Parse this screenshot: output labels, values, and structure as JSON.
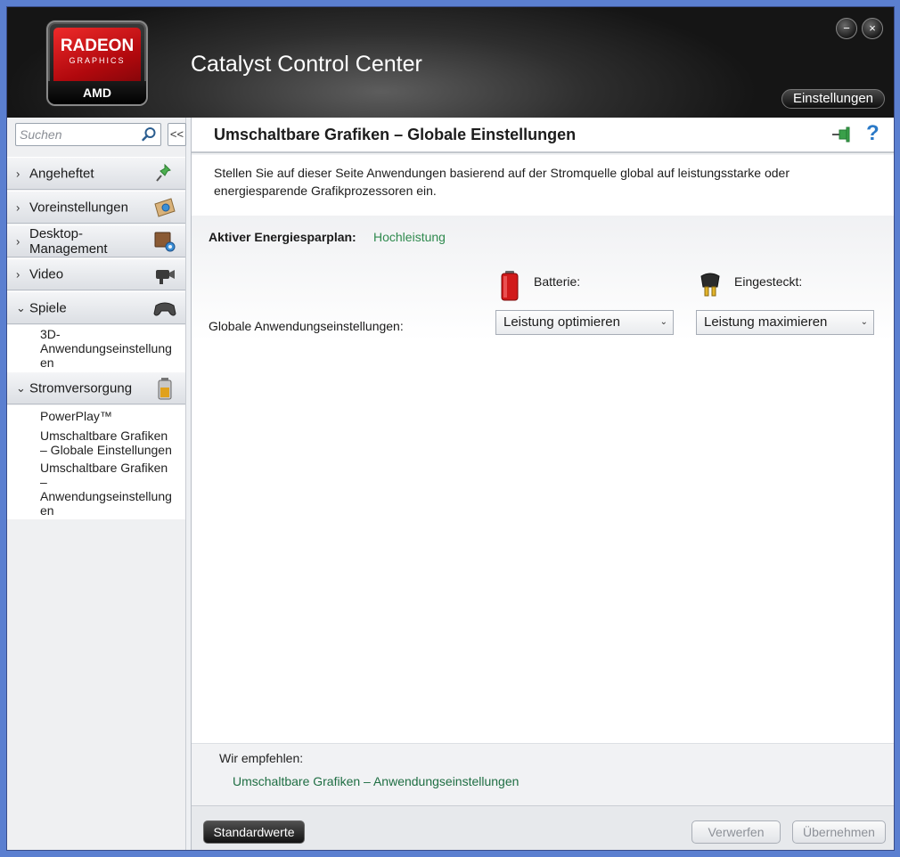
{
  "header": {
    "logo": {
      "brand": "RADEON",
      "sub": "GRAPHICS",
      "maker": "AMD"
    },
    "title": "Catalyst Control Center",
    "minimize_symbol": "−",
    "close_symbol": "×",
    "settings_label": "Einstellungen"
  },
  "sidebar": {
    "search_placeholder": "Suchen",
    "collapse_symbol": "<<",
    "sections": [
      {
        "label": "Angeheftet",
        "chevron": "›",
        "icon": "pin-icon"
      },
      {
        "label": "Voreinstellungen",
        "chevron": "›",
        "icon": "presets-icon"
      },
      {
        "label": "Desktop-\nManagement",
        "chevron": "›",
        "icon": "desktop-management-icon"
      },
      {
        "label": "Video",
        "chevron": "›",
        "icon": "video-camera-icon"
      },
      {
        "label": "Spiele",
        "chevron": "⌄",
        "icon": "gamepad-icon"
      },
      {
        "label": "Stromversorgung",
        "chevron": "⌄",
        "icon": "battery-icon"
      }
    ],
    "games_items": [
      "3D-\nAnwendungseinstellung\nen"
    ],
    "power_items": [
      "PowerPlay™",
      "Umschaltbare Grafiken\n– Globale Einstellungen",
      "Umschaltbare Grafiken\n–\nAnwendungseinstellung\nen"
    ]
  },
  "main": {
    "page_title": "Umschaltbare Grafiken – Globale Einstellungen",
    "help_symbol": "?",
    "description": "Stellen Sie auf dieser Seite Anwendungen basierend auf der Stromquelle global auf leistungsstarke oder energiesparende Grafikprozessoren ein.",
    "plan_label": "Aktiver Energiesparplan:",
    "plan_value": "Hochleistung",
    "battery_label": "Batterie:",
    "plugged_label": "Eingesteckt:",
    "global_label": "Globale Anwendungseinstellungen:",
    "battery_select": "Leistung optimieren",
    "plugged_select": "Leistung maximieren",
    "dropdown_arrow": "⌄",
    "recommend_label": "Wir empfehlen:",
    "recommend_link": "Umschaltbare Grafiken – Anwendungseinstellungen"
  },
  "footer": {
    "defaults_label": "Standardwerte",
    "discard_label": "Verwerfen",
    "apply_label": "Übernehmen"
  },
  "colors": {
    "accent_green": "#2f8a4e",
    "link_green": "#1f6e43",
    "help_blue": "#2a79c7",
    "radeon_red": "#c8101a"
  }
}
